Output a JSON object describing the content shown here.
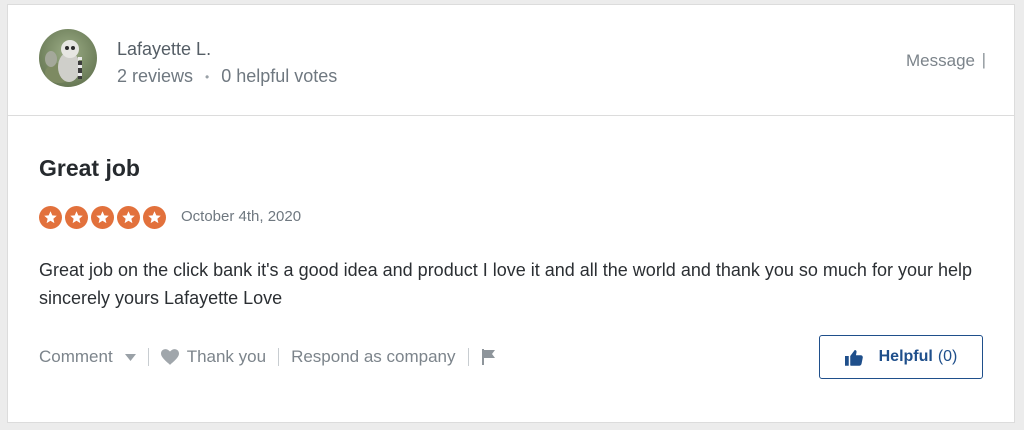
{
  "reviewer": {
    "name": "Lafayette L.",
    "reviews": "2 reviews",
    "separator": "•",
    "helpful_votes": "0 helpful votes"
  },
  "header_actions": {
    "message_label": "Message",
    "divider": "|"
  },
  "review": {
    "title": "Great job",
    "rating": 5,
    "date": "October 4th, 2020",
    "body": "Great job on the click bank it's a good idea and product I love it and all the world and thank you so much for your help sincerely yours Lafayette Love"
  },
  "actions": {
    "comment_label": "Comment",
    "thank_you_label": "Thank you",
    "respond_label": "Respond as company",
    "helpful_label": "Helpful",
    "helpful_count": "(0)"
  },
  "colors": {
    "star": "#e2713c",
    "accent": "#1f4f8b"
  },
  "icons": {
    "comment_dropdown": "chevron-down-icon",
    "thank_you": "heart-icon",
    "report": "flag-icon",
    "helpful": "thumbs-up-icon"
  }
}
